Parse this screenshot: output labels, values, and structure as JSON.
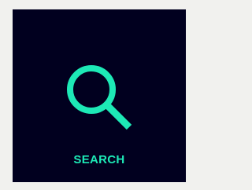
{
  "search_tile": {
    "label": "SEARCH",
    "icon": "search-icon",
    "accent_color": "#1de9b6",
    "background_color": "#01001f"
  }
}
